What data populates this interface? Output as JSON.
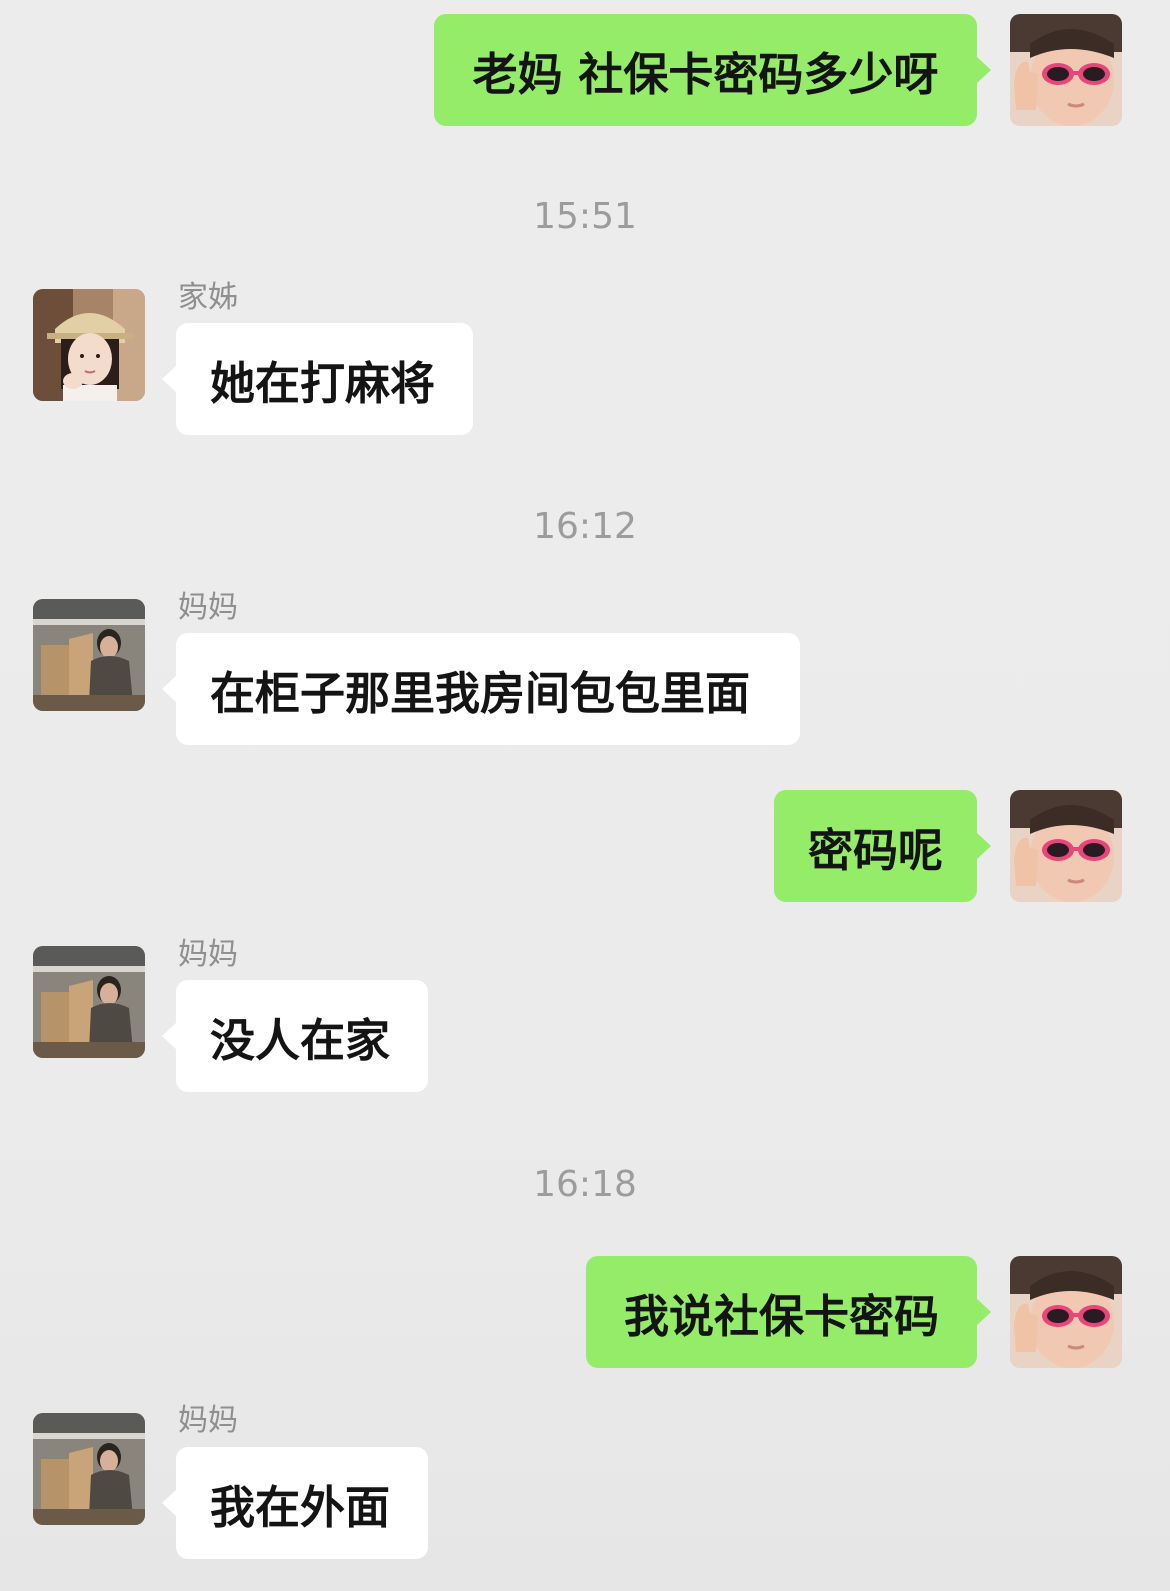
{
  "conversation": [
    {
      "type": "outgoing",
      "text": "老妈 社保卡密码多少呀",
      "avatar": "kid-sunglasses-avatar"
    },
    {
      "type": "timestamp",
      "text": "15:51"
    },
    {
      "type": "incoming",
      "sender": "家姊",
      "text": "她在打麻将",
      "avatar": "sister-avatar"
    },
    {
      "type": "timestamp",
      "text": "16:12"
    },
    {
      "type": "incoming",
      "sender": "妈妈",
      "text": "在柜子那里我房间包包里面",
      "avatar": "mom-avatar"
    },
    {
      "type": "outgoing",
      "text": "密码呢",
      "avatar": "kid-sunglasses-avatar"
    },
    {
      "type": "incoming",
      "sender": "妈妈",
      "text": "没人在家",
      "avatar": "mom-avatar"
    },
    {
      "type": "timestamp",
      "text": "16:18"
    },
    {
      "type": "outgoing",
      "text": "我说社保卡密码",
      "avatar": "kid-sunglasses-avatar"
    },
    {
      "type": "incoming",
      "sender": "妈妈",
      "text": "我在外面",
      "avatar": "mom-avatar"
    }
  ],
  "colors": {
    "background": "#ececec",
    "outgoing_bubble": "#95ec69",
    "incoming_bubble": "#ffffff",
    "timestamp_text": "#9c9c9c",
    "sender_name": "#8f8f8f"
  }
}
